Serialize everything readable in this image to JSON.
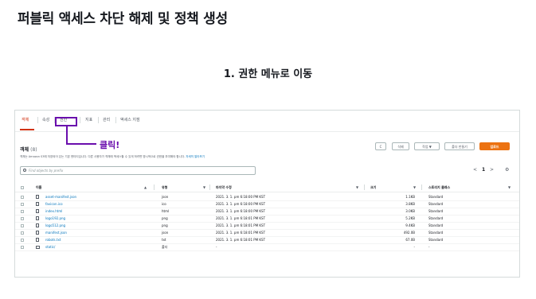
{
  "page_title": "퍼블릭 액세스 차단 해제 및 정책 생성",
  "step_title": "1. 권한 메뉴로 이동",
  "tabs": [
    {
      "label": "객체",
      "active": true
    },
    {
      "label": "속성",
      "active": false
    },
    {
      "label": "권한",
      "active": false,
      "highlighted": true
    },
    {
      "label": "지표",
      "active": false
    },
    {
      "label": "관리",
      "active": false
    },
    {
      "label": "액세스 지점",
      "active": false
    }
  ],
  "callout": {
    "label": "클릭!",
    "color": "#6a0dad"
  },
  "objects": {
    "title": "객체",
    "count": "(8)",
    "description": "객체는 Amazon S3에 저장되어 있는 기본 엔티티입니다. 다른 사용자가 객체에 액세스할 수 있게 하려면 명시적으로 권한을 부여해야 합니다.",
    "learn_more": "자세히 알아보기",
    "buttons": {
      "refresh": "C",
      "delete": "삭제",
      "actions": "작업 ▼",
      "create_folder": "폴더 만들기",
      "upload": "업로드"
    },
    "search_placeholder": "Find objects by prefix",
    "pager": {
      "prev": "<",
      "page": "1",
      "next": ">",
      "settings": "⚙"
    },
    "columns": [
      "이름",
      "유형",
      "마지막 수정",
      "크기",
      "스토리지 클래스"
    ],
    "rows": [
      {
        "name": "asset-manifest.json",
        "type": "json",
        "modified": "2021. 3. 1. pm 6:18:00 PM KST",
        "size": "1.1KB",
        "storage": "Standard",
        "kind": "file"
      },
      {
        "name": "favicon.ico",
        "type": "ico",
        "modified": "2021. 3. 1. pm 6:18:00 PM KST",
        "size": "3.8KB",
        "storage": "Standard",
        "kind": "file"
      },
      {
        "name": "index.html",
        "type": "html",
        "modified": "2021. 3. 1. pm 6:18:00 PM KST",
        "size": "3.0KB",
        "storage": "Standard",
        "kind": "file"
      },
      {
        "name": "logo192.png",
        "type": "png",
        "modified": "2021. 3. 1. pm 6:18:01 PM KST",
        "size": "5.2KB",
        "storage": "Standard",
        "kind": "file"
      },
      {
        "name": "logo512.png",
        "type": "png",
        "modified": "2021. 3. 1. pm 6:18:01 PM KST",
        "size": "9.4KB",
        "storage": "Standard",
        "kind": "file"
      },
      {
        "name": "manifest.json",
        "type": "json",
        "modified": "2021. 3. 1. pm 6:18:01 PM KST",
        "size": "492.0B",
        "storage": "Standard",
        "kind": "file"
      },
      {
        "name": "robots.txt",
        "type": "txt",
        "modified": "2021. 3. 1. pm 6:18:01 PM KST",
        "size": "67.0B",
        "storage": "Standard",
        "kind": "file"
      },
      {
        "name": "static/",
        "type": "폴더",
        "modified": "-",
        "size": "-",
        "storage": "-",
        "kind": "folder"
      }
    ]
  }
}
